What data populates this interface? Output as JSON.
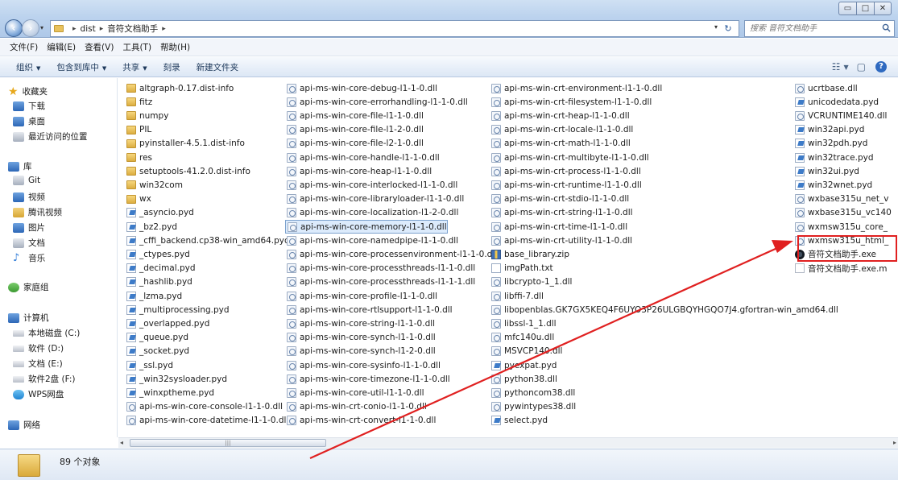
{
  "window": {
    "min_label": "▭",
    "max_label": "□",
    "close_label": "✕"
  },
  "address": {
    "crumbs": [
      "dist",
      "音符文档助手"
    ]
  },
  "search": {
    "placeholder": "搜索 音符文档助手"
  },
  "menu": [
    "文件(F)",
    "编辑(E)",
    "查看(V)",
    "工具(T)",
    "帮助(H)"
  ],
  "toolbar": {
    "organize": "组织",
    "include_library": "包含到库中",
    "share": "共享",
    "burn": "刻录",
    "new_folder": "新建文件夹"
  },
  "nav": {
    "favorites": "收藏夹",
    "downloads": "下载",
    "desktop": "桌面",
    "recent": "最近访问的位置",
    "libraries": "库",
    "git": "Git",
    "video": "视频",
    "tencent_video": "腾讯视频",
    "pictures": "图片",
    "documents": "文档",
    "music": "音乐",
    "homegroup": "家庭组",
    "computer": "计算机",
    "drive_c": "本地磁盘 (C:)",
    "drive_d": "软件 (D:)",
    "drive_e": "文档 (E:)",
    "drive_f": "软件2盘 (F:)",
    "wps": "WPS网盘",
    "network": "网络"
  },
  "files": {
    "col1": [
      {
        "name": "altgraph-0.17.dist-info",
        "icon": "folder"
      },
      {
        "name": "fitz",
        "icon": "folder"
      },
      {
        "name": "numpy",
        "icon": "folder"
      },
      {
        "name": "PIL",
        "icon": "folder"
      },
      {
        "name": "pyinstaller-4.5.1.dist-info",
        "icon": "folder"
      },
      {
        "name": "res",
        "icon": "folder"
      },
      {
        "name": "setuptools-41.2.0.dist-info",
        "icon": "folder"
      },
      {
        "name": "win32com",
        "icon": "folder"
      },
      {
        "name": "wx",
        "icon": "folder"
      },
      {
        "name": "_asyncio.pyd",
        "icon": "pyd"
      },
      {
        "name": "_bz2.pyd",
        "icon": "pyd"
      },
      {
        "name": "_cffi_backend.cp38-win_amd64.pyd",
        "icon": "pyd"
      },
      {
        "name": "_ctypes.pyd",
        "icon": "pyd"
      },
      {
        "name": "_decimal.pyd",
        "icon": "pyd"
      },
      {
        "name": "_hashlib.pyd",
        "icon": "pyd"
      },
      {
        "name": "_lzma.pyd",
        "icon": "pyd"
      },
      {
        "name": "_multiprocessing.pyd",
        "icon": "pyd"
      },
      {
        "name": "_overlapped.pyd",
        "icon": "pyd"
      },
      {
        "name": "_queue.pyd",
        "icon": "pyd"
      },
      {
        "name": "_socket.pyd",
        "icon": "pyd"
      },
      {
        "name": "_ssl.pyd",
        "icon": "pyd"
      },
      {
        "name": "_win32sysloader.pyd",
        "icon": "pyd"
      },
      {
        "name": "_winxptheme.pyd",
        "icon": "pyd"
      },
      {
        "name": "api-ms-win-core-console-l1-1-0.dll",
        "icon": "dll"
      },
      {
        "name": "api-ms-win-core-datetime-l1-1-0.dll",
        "icon": "dll"
      }
    ],
    "col2": [
      {
        "name": "api-ms-win-core-debug-l1-1-0.dll",
        "icon": "dll"
      },
      {
        "name": "api-ms-win-core-errorhandling-l1-1-0.dll",
        "icon": "dll"
      },
      {
        "name": "api-ms-win-core-file-l1-1-0.dll",
        "icon": "dll"
      },
      {
        "name": "api-ms-win-core-file-l1-2-0.dll",
        "icon": "dll"
      },
      {
        "name": "api-ms-win-core-file-l2-1-0.dll",
        "icon": "dll"
      },
      {
        "name": "api-ms-win-core-handle-l1-1-0.dll",
        "icon": "dll"
      },
      {
        "name": "api-ms-win-core-heap-l1-1-0.dll",
        "icon": "dll"
      },
      {
        "name": "api-ms-win-core-interlocked-l1-1-0.dll",
        "icon": "dll"
      },
      {
        "name": "api-ms-win-core-libraryloader-l1-1-0.dll",
        "icon": "dll"
      },
      {
        "name": "api-ms-win-core-localization-l1-2-0.dll",
        "icon": "dll"
      },
      {
        "name": "api-ms-win-core-memory-l1-1-0.dll",
        "icon": "dll",
        "selected": true
      },
      {
        "name": "api-ms-win-core-namedpipe-l1-1-0.dll",
        "icon": "dll"
      },
      {
        "name": "api-ms-win-core-processenvironment-l1-1-0.dll",
        "icon": "dll"
      },
      {
        "name": "api-ms-win-core-processthreads-l1-1-0.dll",
        "icon": "dll"
      },
      {
        "name": "api-ms-win-core-processthreads-l1-1-1.dll",
        "icon": "dll"
      },
      {
        "name": "api-ms-win-core-profile-l1-1-0.dll",
        "icon": "dll"
      },
      {
        "name": "api-ms-win-core-rtlsupport-l1-1-0.dll",
        "icon": "dll"
      },
      {
        "name": "api-ms-win-core-string-l1-1-0.dll",
        "icon": "dll"
      },
      {
        "name": "api-ms-win-core-synch-l1-1-0.dll",
        "icon": "dll"
      },
      {
        "name": "api-ms-win-core-synch-l1-2-0.dll",
        "icon": "dll"
      },
      {
        "name": "api-ms-win-core-sysinfo-l1-1-0.dll",
        "icon": "dll"
      },
      {
        "name": "api-ms-win-core-timezone-l1-1-0.dll",
        "icon": "dll"
      },
      {
        "name": "api-ms-win-core-util-l1-1-0.dll",
        "icon": "dll"
      },
      {
        "name": "api-ms-win-crt-conio-l1-1-0.dll",
        "icon": "dll"
      },
      {
        "name": "api-ms-win-crt-convert-l1-1-0.dll",
        "icon": "dll"
      }
    ],
    "col3": [
      {
        "name": "api-ms-win-crt-environment-l1-1-0.dll",
        "icon": "dll"
      },
      {
        "name": "api-ms-win-crt-filesystem-l1-1-0.dll",
        "icon": "dll"
      },
      {
        "name": "api-ms-win-crt-heap-l1-1-0.dll",
        "icon": "dll"
      },
      {
        "name": "api-ms-win-crt-locale-l1-1-0.dll",
        "icon": "dll"
      },
      {
        "name": "api-ms-win-crt-math-l1-1-0.dll",
        "icon": "dll"
      },
      {
        "name": "api-ms-win-crt-multibyte-l1-1-0.dll",
        "icon": "dll"
      },
      {
        "name": "api-ms-win-crt-process-l1-1-0.dll",
        "icon": "dll"
      },
      {
        "name": "api-ms-win-crt-runtime-l1-1-0.dll",
        "icon": "dll"
      },
      {
        "name": "api-ms-win-crt-stdio-l1-1-0.dll",
        "icon": "dll"
      },
      {
        "name": "api-ms-win-crt-string-l1-1-0.dll",
        "icon": "dll"
      },
      {
        "name": "api-ms-win-crt-time-l1-1-0.dll",
        "icon": "dll"
      },
      {
        "name": "api-ms-win-crt-utility-l1-1-0.dll",
        "icon": "dll"
      },
      {
        "name": "base_library.zip",
        "icon": "zip"
      },
      {
        "name": "imgPath.txt",
        "icon": "txt"
      },
      {
        "name": "libcrypto-1_1.dll",
        "icon": "dll"
      },
      {
        "name": "libffi-7.dll",
        "icon": "dll"
      },
      {
        "name": "libopenblas.GK7GX5KEQ4F6UYO3P26ULGBQYHGQO7J4.gfortran-win_amd64.dll",
        "icon": "dll"
      },
      {
        "name": "libssl-1_1.dll",
        "icon": "dll"
      },
      {
        "name": "mfc140u.dll",
        "icon": "dll"
      },
      {
        "name": "MSVCP140.dll",
        "icon": "dll"
      },
      {
        "name": "pyexpat.pyd",
        "icon": "pyd"
      },
      {
        "name": "python38.dll",
        "icon": "dll"
      },
      {
        "name": "pythoncom38.dll",
        "icon": "dll"
      },
      {
        "name": "pywintypes38.dll",
        "icon": "dll"
      },
      {
        "name": "select.pyd",
        "icon": "pyd"
      }
    ],
    "col4": [
      {
        "name": "ucrtbase.dll",
        "icon": "dll"
      },
      {
        "name": "unicodedata.pyd",
        "icon": "pyd"
      },
      {
        "name": "VCRUNTIME140.dll",
        "icon": "dll"
      },
      {
        "name": "win32api.pyd",
        "icon": "pyd"
      },
      {
        "name": "win32pdh.pyd",
        "icon": "pyd"
      },
      {
        "name": "win32trace.pyd",
        "icon": "pyd"
      },
      {
        "name": "win32ui.pyd",
        "icon": "pyd"
      },
      {
        "name": "win32wnet.pyd",
        "icon": "pyd"
      },
      {
        "name": "wxbase315u_net_v",
        "icon": "dll"
      },
      {
        "name": "wxbase315u_vc140",
        "icon": "dll"
      },
      {
        "name": "wxmsw315u_core_",
        "icon": "dll"
      },
      {
        "name": "wxmsw315u_html_",
        "icon": "dll"
      },
      {
        "name": "音符文档助手.exe",
        "icon": "exe"
      },
      {
        "name": "音符文档助手.exe.m",
        "icon": "blank"
      }
    ]
  },
  "scrollbar": {
    "left_arrow": "◂",
    "right_arrow": "▸",
    "grip": "|||"
  },
  "details": {
    "count": "89 个对象"
  },
  "annotation": {
    "color": "#e02020"
  }
}
